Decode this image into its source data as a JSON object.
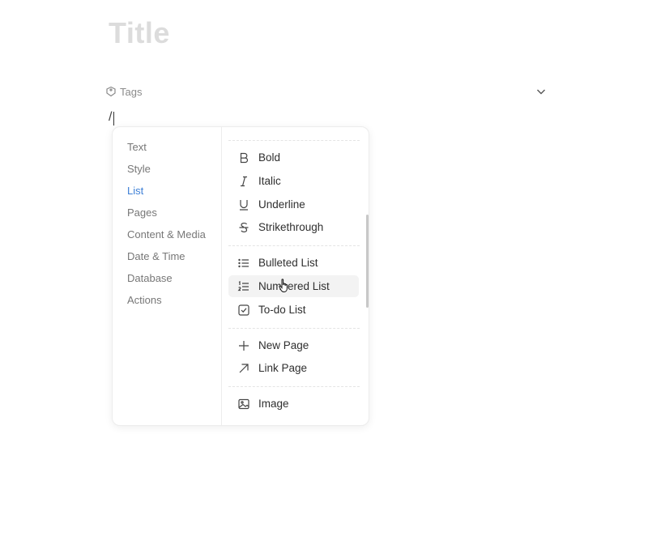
{
  "page": {
    "title": "Title"
  },
  "tags": {
    "label": "Tags",
    "icon": "tag-icon",
    "toggle_icon": "chevron-down-icon"
  },
  "editor": {
    "typed": "/"
  },
  "menu": {
    "categories": [
      {
        "label": "Text",
        "active": false
      },
      {
        "label": "Style",
        "active": false
      },
      {
        "label": "List",
        "active": true
      },
      {
        "label": "Pages",
        "active": false
      },
      {
        "label": "Content & Media",
        "active": false
      },
      {
        "label": "Date & Time",
        "active": false
      },
      {
        "label": "Database",
        "active": false
      },
      {
        "label": "Actions",
        "active": false
      }
    ],
    "options": [
      {
        "label": "Bold",
        "icon": "bold-icon"
      },
      {
        "label": "Italic",
        "icon": "italic-icon"
      },
      {
        "label": "Underline",
        "icon": "underline-icon"
      },
      {
        "label": "Strikethrough",
        "icon": "strikethrough-icon"
      },
      {
        "label": "Bulleted List",
        "icon": "bulleted-list-icon"
      },
      {
        "label": "Numbered List",
        "icon": "numbered-list-icon",
        "hovered": true
      },
      {
        "label": "To-do List",
        "icon": "todo-checkbox-icon"
      },
      {
        "label": "New Page",
        "icon": "plus-icon"
      },
      {
        "label": "Link Page",
        "icon": "arrow-up-right-icon"
      },
      {
        "label": "Image",
        "icon": "image-icon"
      }
    ],
    "accent_color": "#3d7fd6"
  }
}
